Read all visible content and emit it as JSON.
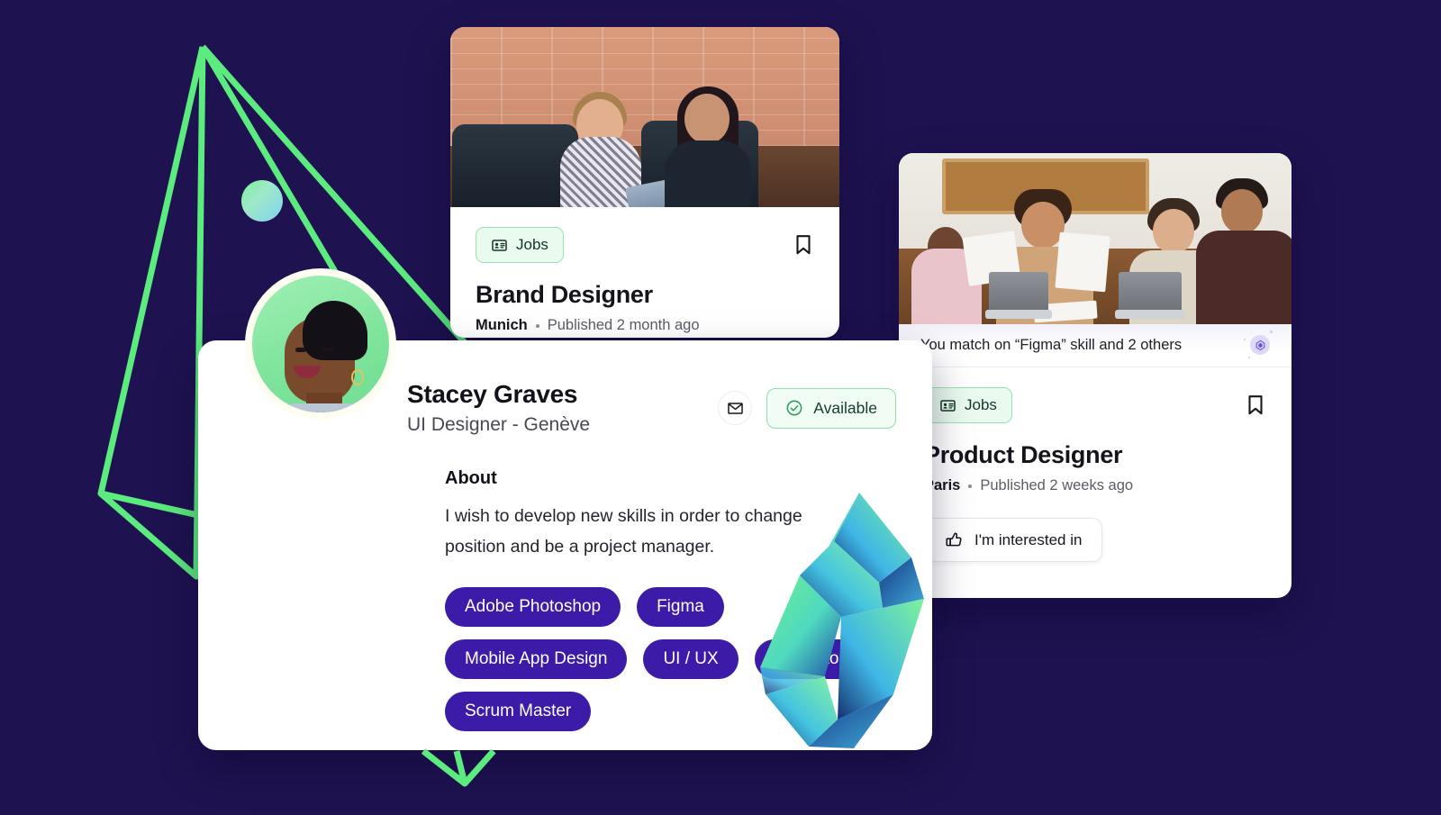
{
  "theme": {
    "background": "#1e1250",
    "accent_green": "#5ceb7e",
    "tag_purple": "#3b1ba8",
    "badge_green_bg": "#eafaef",
    "badge_green_border": "#9ae2ae"
  },
  "brand_card": {
    "badge_label": "Jobs",
    "badge_icon": "id-card-icon",
    "bookmark_icon": "bookmark-icon",
    "title": "Brand Designer",
    "location": "Munich",
    "published": "Published 2 month ago",
    "photo_alt": "two-women-meeting-photo"
  },
  "product_card": {
    "match_text": "You match on “Figma” skill and 2 others",
    "match_icon": "gem-sparkle-icon",
    "badge_label": "Jobs",
    "badge_icon": "id-card-icon",
    "bookmark_icon": "bookmark-icon",
    "title": "Product Designer",
    "location": "Paris",
    "published": "Published 2 weeks ago",
    "interested_label": "I'm interested in",
    "interested_icon": "thumbs-up-icon",
    "photo_alt": "team-meeting-photo"
  },
  "profile_card": {
    "name": "Stacey Graves",
    "role": "UI Designer - Genève",
    "avatar_alt": "stacey-graves-avatar",
    "mail_icon": "mail-icon",
    "status": {
      "label": "Available",
      "icon": "check-circle-icon"
    },
    "about_title": "About",
    "about_text": "I wish to develop new skills in order to change position and be a project manager.",
    "tags": [
      "Adobe Photoshop",
      "Figma",
      "Mobile App Design",
      "UI / UX",
      "Illustrator",
      "Scrum Master"
    ]
  },
  "decor": {
    "pyramid": "green-wireframe-pyramid",
    "sphere": "gradient-sphere",
    "crystal": "gradient-crystal"
  }
}
